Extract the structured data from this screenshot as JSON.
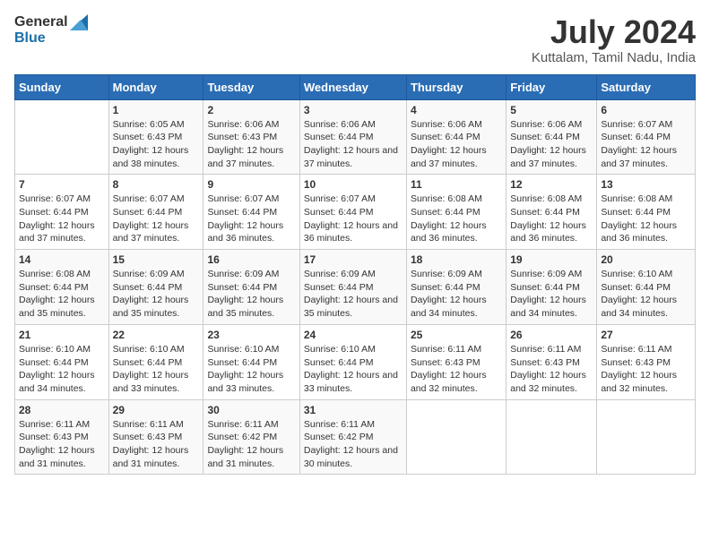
{
  "logo": {
    "name_line1": "General",
    "name_line2": "Blue"
  },
  "title": "July 2024",
  "subtitle": "Kuttalam, Tamil Nadu, India",
  "header_days": [
    "Sunday",
    "Monday",
    "Tuesday",
    "Wednesday",
    "Thursday",
    "Friday",
    "Saturday"
  ],
  "weeks": [
    [
      {
        "num": "",
        "sunrise": "",
        "sunset": "",
        "daylight": ""
      },
      {
        "num": "1",
        "sunrise": "Sunrise: 6:05 AM",
        "sunset": "Sunset: 6:43 PM",
        "daylight": "Daylight: 12 hours and 38 minutes."
      },
      {
        "num": "2",
        "sunrise": "Sunrise: 6:06 AM",
        "sunset": "Sunset: 6:43 PM",
        "daylight": "Daylight: 12 hours and 37 minutes."
      },
      {
        "num": "3",
        "sunrise": "Sunrise: 6:06 AM",
        "sunset": "Sunset: 6:44 PM",
        "daylight": "Daylight: 12 hours and 37 minutes."
      },
      {
        "num": "4",
        "sunrise": "Sunrise: 6:06 AM",
        "sunset": "Sunset: 6:44 PM",
        "daylight": "Daylight: 12 hours and 37 minutes."
      },
      {
        "num": "5",
        "sunrise": "Sunrise: 6:06 AM",
        "sunset": "Sunset: 6:44 PM",
        "daylight": "Daylight: 12 hours and 37 minutes."
      },
      {
        "num": "6",
        "sunrise": "Sunrise: 6:07 AM",
        "sunset": "Sunset: 6:44 PM",
        "daylight": "Daylight: 12 hours and 37 minutes."
      }
    ],
    [
      {
        "num": "7",
        "sunrise": "Sunrise: 6:07 AM",
        "sunset": "Sunset: 6:44 PM",
        "daylight": "Daylight: 12 hours and 37 minutes."
      },
      {
        "num": "8",
        "sunrise": "Sunrise: 6:07 AM",
        "sunset": "Sunset: 6:44 PM",
        "daylight": "Daylight: 12 hours and 37 minutes."
      },
      {
        "num": "9",
        "sunrise": "Sunrise: 6:07 AM",
        "sunset": "Sunset: 6:44 PM",
        "daylight": "Daylight: 12 hours and 36 minutes."
      },
      {
        "num": "10",
        "sunrise": "Sunrise: 6:07 AM",
        "sunset": "Sunset: 6:44 PM",
        "daylight": "Daylight: 12 hours and 36 minutes."
      },
      {
        "num": "11",
        "sunrise": "Sunrise: 6:08 AM",
        "sunset": "Sunset: 6:44 PM",
        "daylight": "Daylight: 12 hours and 36 minutes."
      },
      {
        "num": "12",
        "sunrise": "Sunrise: 6:08 AM",
        "sunset": "Sunset: 6:44 PM",
        "daylight": "Daylight: 12 hours and 36 minutes."
      },
      {
        "num": "13",
        "sunrise": "Sunrise: 6:08 AM",
        "sunset": "Sunset: 6:44 PM",
        "daylight": "Daylight: 12 hours and 36 minutes."
      }
    ],
    [
      {
        "num": "14",
        "sunrise": "Sunrise: 6:08 AM",
        "sunset": "Sunset: 6:44 PM",
        "daylight": "Daylight: 12 hours and 35 minutes."
      },
      {
        "num": "15",
        "sunrise": "Sunrise: 6:09 AM",
        "sunset": "Sunset: 6:44 PM",
        "daylight": "Daylight: 12 hours and 35 minutes."
      },
      {
        "num": "16",
        "sunrise": "Sunrise: 6:09 AM",
        "sunset": "Sunset: 6:44 PM",
        "daylight": "Daylight: 12 hours and 35 minutes."
      },
      {
        "num": "17",
        "sunrise": "Sunrise: 6:09 AM",
        "sunset": "Sunset: 6:44 PM",
        "daylight": "Daylight: 12 hours and 35 minutes."
      },
      {
        "num": "18",
        "sunrise": "Sunrise: 6:09 AM",
        "sunset": "Sunset: 6:44 PM",
        "daylight": "Daylight: 12 hours and 34 minutes."
      },
      {
        "num": "19",
        "sunrise": "Sunrise: 6:09 AM",
        "sunset": "Sunset: 6:44 PM",
        "daylight": "Daylight: 12 hours and 34 minutes."
      },
      {
        "num": "20",
        "sunrise": "Sunrise: 6:10 AM",
        "sunset": "Sunset: 6:44 PM",
        "daylight": "Daylight: 12 hours and 34 minutes."
      }
    ],
    [
      {
        "num": "21",
        "sunrise": "Sunrise: 6:10 AM",
        "sunset": "Sunset: 6:44 PM",
        "daylight": "Daylight: 12 hours and 34 minutes."
      },
      {
        "num": "22",
        "sunrise": "Sunrise: 6:10 AM",
        "sunset": "Sunset: 6:44 PM",
        "daylight": "Daylight: 12 hours and 33 minutes."
      },
      {
        "num": "23",
        "sunrise": "Sunrise: 6:10 AM",
        "sunset": "Sunset: 6:44 PM",
        "daylight": "Daylight: 12 hours and 33 minutes."
      },
      {
        "num": "24",
        "sunrise": "Sunrise: 6:10 AM",
        "sunset": "Sunset: 6:44 PM",
        "daylight": "Daylight: 12 hours and 33 minutes."
      },
      {
        "num": "25",
        "sunrise": "Sunrise: 6:11 AM",
        "sunset": "Sunset: 6:43 PM",
        "daylight": "Daylight: 12 hours and 32 minutes."
      },
      {
        "num": "26",
        "sunrise": "Sunrise: 6:11 AM",
        "sunset": "Sunset: 6:43 PM",
        "daylight": "Daylight: 12 hours and 32 minutes."
      },
      {
        "num": "27",
        "sunrise": "Sunrise: 6:11 AM",
        "sunset": "Sunset: 6:43 PM",
        "daylight": "Daylight: 12 hours and 32 minutes."
      }
    ],
    [
      {
        "num": "28",
        "sunrise": "Sunrise: 6:11 AM",
        "sunset": "Sunset: 6:43 PM",
        "daylight": "Daylight: 12 hours and 31 minutes."
      },
      {
        "num": "29",
        "sunrise": "Sunrise: 6:11 AM",
        "sunset": "Sunset: 6:43 PM",
        "daylight": "Daylight: 12 hours and 31 minutes."
      },
      {
        "num": "30",
        "sunrise": "Sunrise: 6:11 AM",
        "sunset": "Sunset: 6:42 PM",
        "daylight": "Daylight: 12 hours and 31 minutes."
      },
      {
        "num": "31",
        "sunrise": "Sunrise: 6:11 AM",
        "sunset": "Sunset: 6:42 PM",
        "daylight": "Daylight: 12 hours and 30 minutes."
      },
      {
        "num": "",
        "sunrise": "",
        "sunset": "",
        "daylight": ""
      },
      {
        "num": "",
        "sunrise": "",
        "sunset": "",
        "daylight": ""
      },
      {
        "num": "",
        "sunrise": "",
        "sunset": "",
        "daylight": ""
      }
    ]
  ]
}
